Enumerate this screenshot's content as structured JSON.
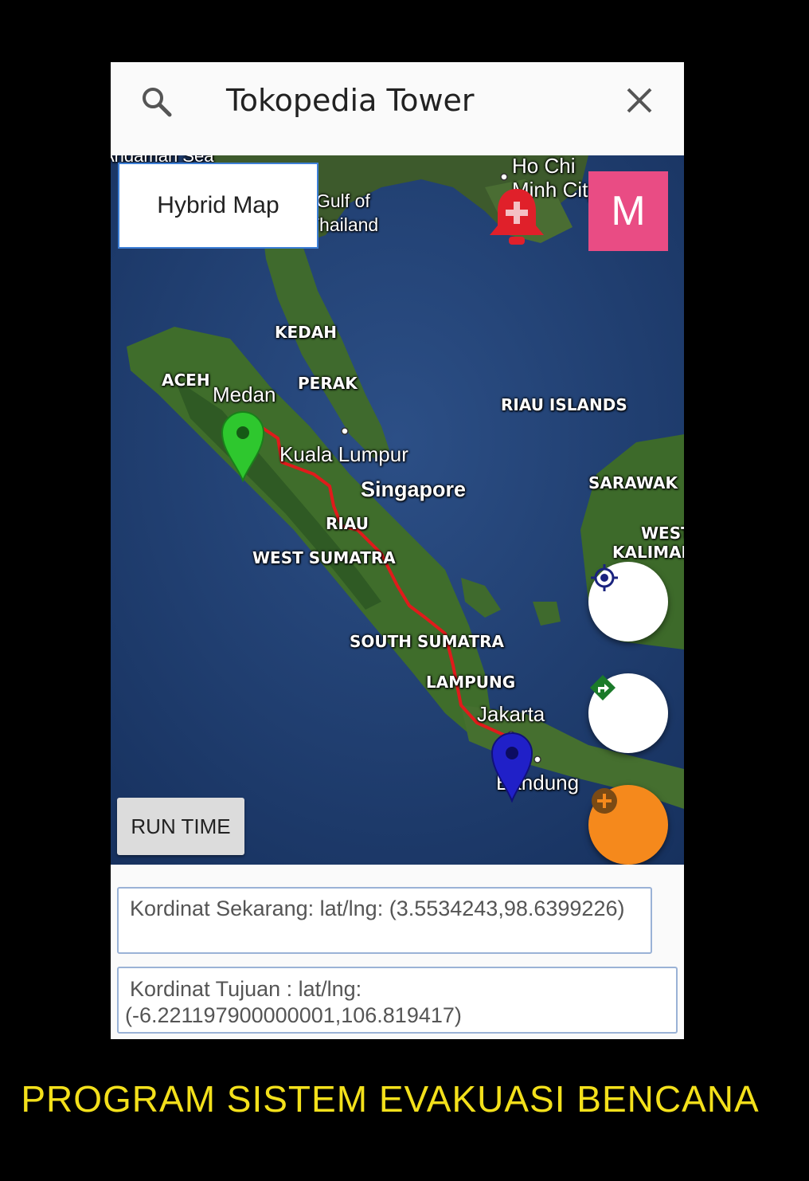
{
  "search": {
    "query": "Tokopedia Tower"
  },
  "map": {
    "type_button": "Hybrid Map",
    "menu_button": "M",
    "runtime_button": "RUN TIME",
    "labels": {
      "andaman": "Andaman Sea",
      "gulf1": "Gulf of",
      "gulf2": "Thailand",
      "hochi1": "Ho Chi",
      "hochi2": "Minh City",
      "kedah": "KEDAH",
      "aceh": "ACEH",
      "perak": "PERAK",
      "medan": "Medan",
      "riau_islands": "RIAU ISLANDS",
      "kuala_lumpur": "Kuala Lumpur",
      "singapore": "Singapore",
      "sarawak": "SARAWAK",
      "west_kal1": "WEST",
      "west_kal2": "KALIMANTAN",
      "riau": "RIAU",
      "west_sumatra": "WEST SUMATRA",
      "south_sumatra": "SOUTH SUMATRA",
      "lampung": "LAMPUNG",
      "jakarta": "Jakarta",
      "bandung": "Bandung"
    },
    "colors": {
      "route": "#e01b1b",
      "origin_marker": "#2ec72e",
      "destination_marker": "#2020c8",
      "alarm": "#e0202a"
    },
    "icons": [
      "search-icon",
      "close-icon",
      "alarm-bell-icon",
      "my-location-icon",
      "directions-icon",
      "add-icon"
    ]
  },
  "coords": {
    "current": "Kordinat Sekarang: lat/lng: (3.5534243,98.6399226)",
    "destination_line1": "Kordinat Tujuan : lat/lng:",
    "destination_line2": "(-6.221197900000001,106.819417)"
  },
  "caption": "PROGRAM SISTEM EVAKUASI BENCANA"
}
